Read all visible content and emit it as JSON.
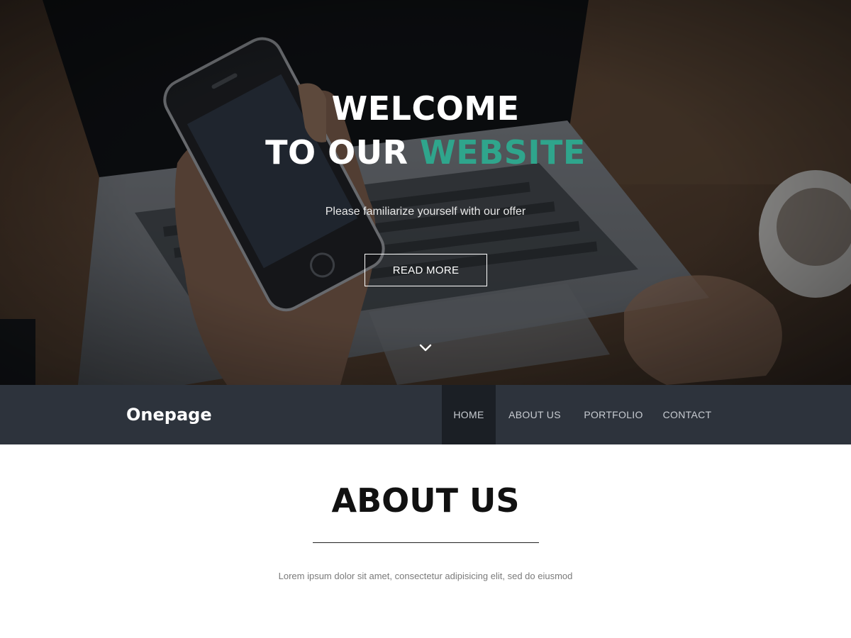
{
  "hero": {
    "title_line1": "WELCOME",
    "title_line2_prefix": "TO OUR ",
    "title_line2_accent": "WEBSITE",
    "subtitle": "Please familiarize yourself with our offer",
    "cta_label": "READ MORE",
    "scroll_icon": "chevron-down-icon",
    "background_image": "hands holding smartphone in front of laptop (blurred, dark overlay)"
  },
  "navbar": {
    "brand": "Onepage",
    "items": [
      {
        "label": "HOME",
        "active": true
      },
      {
        "label": "ABOUT US",
        "active": false
      },
      {
        "label": "PORTFOLIO",
        "active": false
      },
      {
        "label": "CONTACT",
        "active": false
      }
    ]
  },
  "about": {
    "title": "ABOUT US",
    "text": "Lorem ipsum dolor sit amet, consectetur adipisicing elit, sed do eiusmod"
  },
  "colors": {
    "accent": "#2fa58c",
    "navbar_bg": "#2d333c",
    "nav_active_bg": "#1b1f25",
    "hero_text": "#ffffff"
  }
}
